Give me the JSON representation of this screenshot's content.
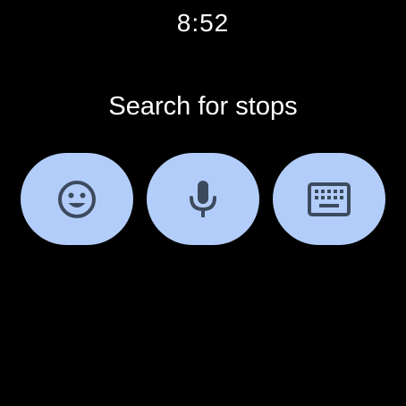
{
  "status_bar": {
    "time": "8:52"
  },
  "main": {
    "prompt": "Search for stops"
  },
  "input_options": [
    {
      "name": "emoji-input-button",
      "icon": "smiley-face-icon"
    },
    {
      "name": "voice-input-button",
      "icon": "microphone-icon"
    },
    {
      "name": "keyboard-input-button",
      "icon": "keyboard-icon"
    }
  ],
  "colors": {
    "background": "#000000",
    "text": "#ffffff",
    "button_fill": "#b3cdfa",
    "icon": "#3c4a5e"
  }
}
